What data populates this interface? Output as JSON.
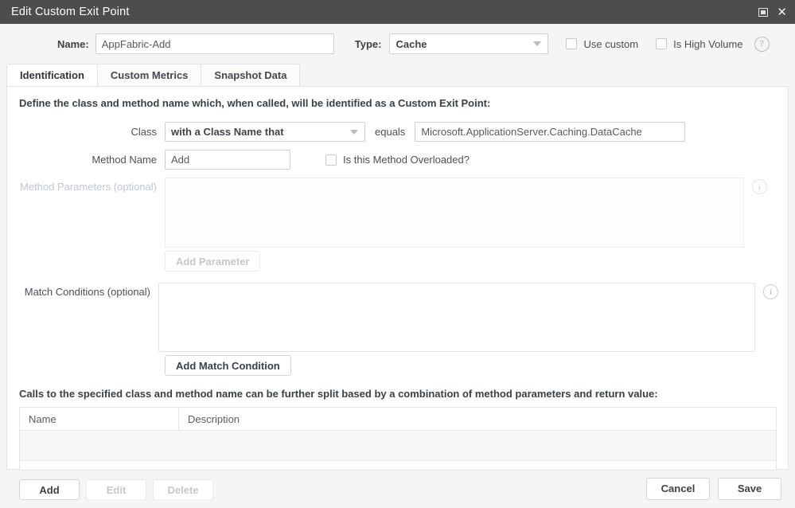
{
  "window": {
    "title": "Edit Custom Exit Point",
    "restore_icon": "restore-window-icon",
    "close_icon": "close-icon"
  },
  "header": {
    "name_label": "Name:",
    "name_value": "AppFabric-Add",
    "type_label": "Type:",
    "type_value": "Cache",
    "use_custom_label": "Use custom",
    "use_custom_checked": false,
    "is_high_volume_label": "Is High Volume",
    "is_high_volume_checked": false,
    "help_glyph": "?"
  },
  "tabs": [
    {
      "label": "Identification",
      "active": true
    },
    {
      "label": "Custom Metrics",
      "active": false
    },
    {
      "label": "Snapshot Data",
      "active": false
    }
  ],
  "identification": {
    "section_title": "Define the class and method name which, when called, will be identified as a Custom Exit Point:",
    "class_label": "Class",
    "class_match_type": "with a Class Name that",
    "equals_label": "equals",
    "class_value": "Microsoft.ApplicationServer.Caching.DataCache",
    "method_name_label": "Method Name",
    "method_name_value": "Add",
    "overloaded_label": "Is this Method Overloaded?",
    "overloaded_checked": false,
    "method_parameters_label": "Method Parameters (optional)",
    "method_parameters_disabled": true,
    "add_parameter_label": "Add Parameter",
    "add_parameter_disabled": true,
    "match_conditions_label": "Match Conditions (optional)",
    "add_match_condition_label": "Add Match Condition",
    "info_glyph": "i"
  },
  "split_section": {
    "note": "Calls to the specified class and method name can be further split based by a combination of method parameters and return value:",
    "columns": [
      "Name",
      "Description"
    ],
    "rows": [],
    "buttons": {
      "add_label": "Add",
      "edit_label": "Edit",
      "delete_label": "Delete",
      "edit_disabled": true,
      "delete_disabled": true
    }
  },
  "footer": {
    "cancel_label": "Cancel",
    "save_label": "Save"
  },
  "colors": {
    "titlebar_bg": "#4d4d4d",
    "page_bg": "#f4f5f6",
    "panel_bg": "#ffffff",
    "border": "#e0e3e6",
    "text": "#44494f",
    "disabled_text": "#c3c8cd"
  }
}
